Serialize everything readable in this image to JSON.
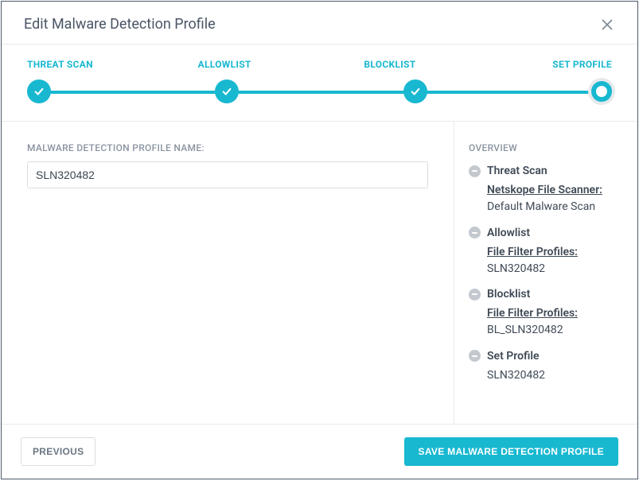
{
  "modal": {
    "title": "Edit Malware Detection Profile"
  },
  "stepper": {
    "steps": [
      {
        "label": "THREAT SCAN",
        "state": "done"
      },
      {
        "label": "ALLOWLIST",
        "state": "done"
      },
      {
        "label": "BLOCKLIST",
        "state": "done"
      },
      {
        "label": "SET PROFILE",
        "state": "current"
      }
    ]
  },
  "form": {
    "profile_name_label": "MALWARE DETECTION PROFILE NAME:",
    "profile_name_value": "SLN320482"
  },
  "overview": {
    "title": "OVERVIEW",
    "items": [
      {
        "head": "Threat Scan",
        "sub_label": "Netskope File Scanner:",
        "sub_value": "Default Malware Scan"
      },
      {
        "head": "Allowlist",
        "sub_label": "File Filter Profiles:",
        "sub_value": "SLN320482"
      },
      {
        "head": "Blocklist",
        "sub_label": "File Filter Profiles:",
        "sub_value": "BL_SLN320482"
      },
      {
        "head": "Set Profile",
        "sub_label": "",
        "sub_value": "SLN320482"
      }
    ]
  },
  "footer": {
    "previous_label": "PREVIOUS",
    "save_label": "SAVE MALWARE DETECTION PROFILE"
  }
}
